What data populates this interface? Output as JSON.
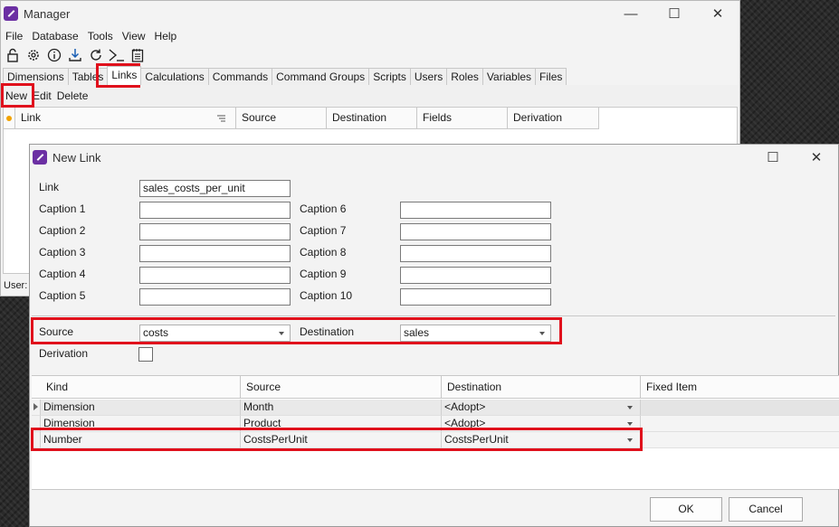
{
  "manager": {
    "title": "Manager",
    "menu": [
      "File",
      "Database",
      "Tools",
      "View",
      "Help"
    ],
    "tabs": [
      "Dimensions",
      "Tables",
      "Links",
      "Calculations",
      "Commands",
      "Command Groups",
      "Scripts",
      "Users",
      "Roles",
      "Variables",
      "Files"
    ],
    "active_tab": "Links",
    "actions": [
      "New",
      "Edit",
      "Delete"
    ],
    "grid_headers": [
      "Link",
      "Source",
      "Destination",
      "Fields",
      "Derivation"
    ],
    "status": "User:",
    "toolbar_icons": [
      "lock-icon",
      "gear-icon",
      "info-icon",
      "download-icon",
      "refresh-icon",
      "terminal-icon",
      "notepad-icon"
    ]
  },
  "dialog": {
    "title": "New Link",
    "link_label": "Link",
    "link_value": "sales_costs_per_unit",
    "captions_left": [
      "Caption 1",
      "Caption 2",
      "Caption 3",
      "Caption 4",
      "Caption 5"
    ],
    "captions_right": [
      "Caption 6",
      "Caption 7",
      "Caption 8",
      "Caption 9",
      "Caption 10"
    ],
    "source_label": "Source",
    "source_value": "costs",
    "destination_label": "Destination",
    "destination_value": "sales",
    "derivation_label": "Derivation",
    "grid_headers": [
      "Kind",
      "Source",
      "Destination",
      "Fixed Item"
    ],
    "rows": [
      {
        "kind": "Dimension",
        "source": "Month",
        "destination": "<Adopt>",
        "fixed": ""
      },
      {
        "kind": "Dimension",
        "source": "Product",
        "destination": "<Adopt>",
        "fixed": ""
      },
      {
        "kind": "Number",
        "source": "CostsPerUnit",
        "destination": "CostsPerUnit",
        "fixed": ""
      }
    ],
    "ok_label": "OK",
    "cancel_label": "Cancel"
  },
  "window_controls": {
    "minimize": "—",
    "maximize": "☐",
    "close": "✕"
  },
  "colors": {
    "accent_purple": "#6b2fa3",
    "highlight_red": "#e0101c"
  }
}
